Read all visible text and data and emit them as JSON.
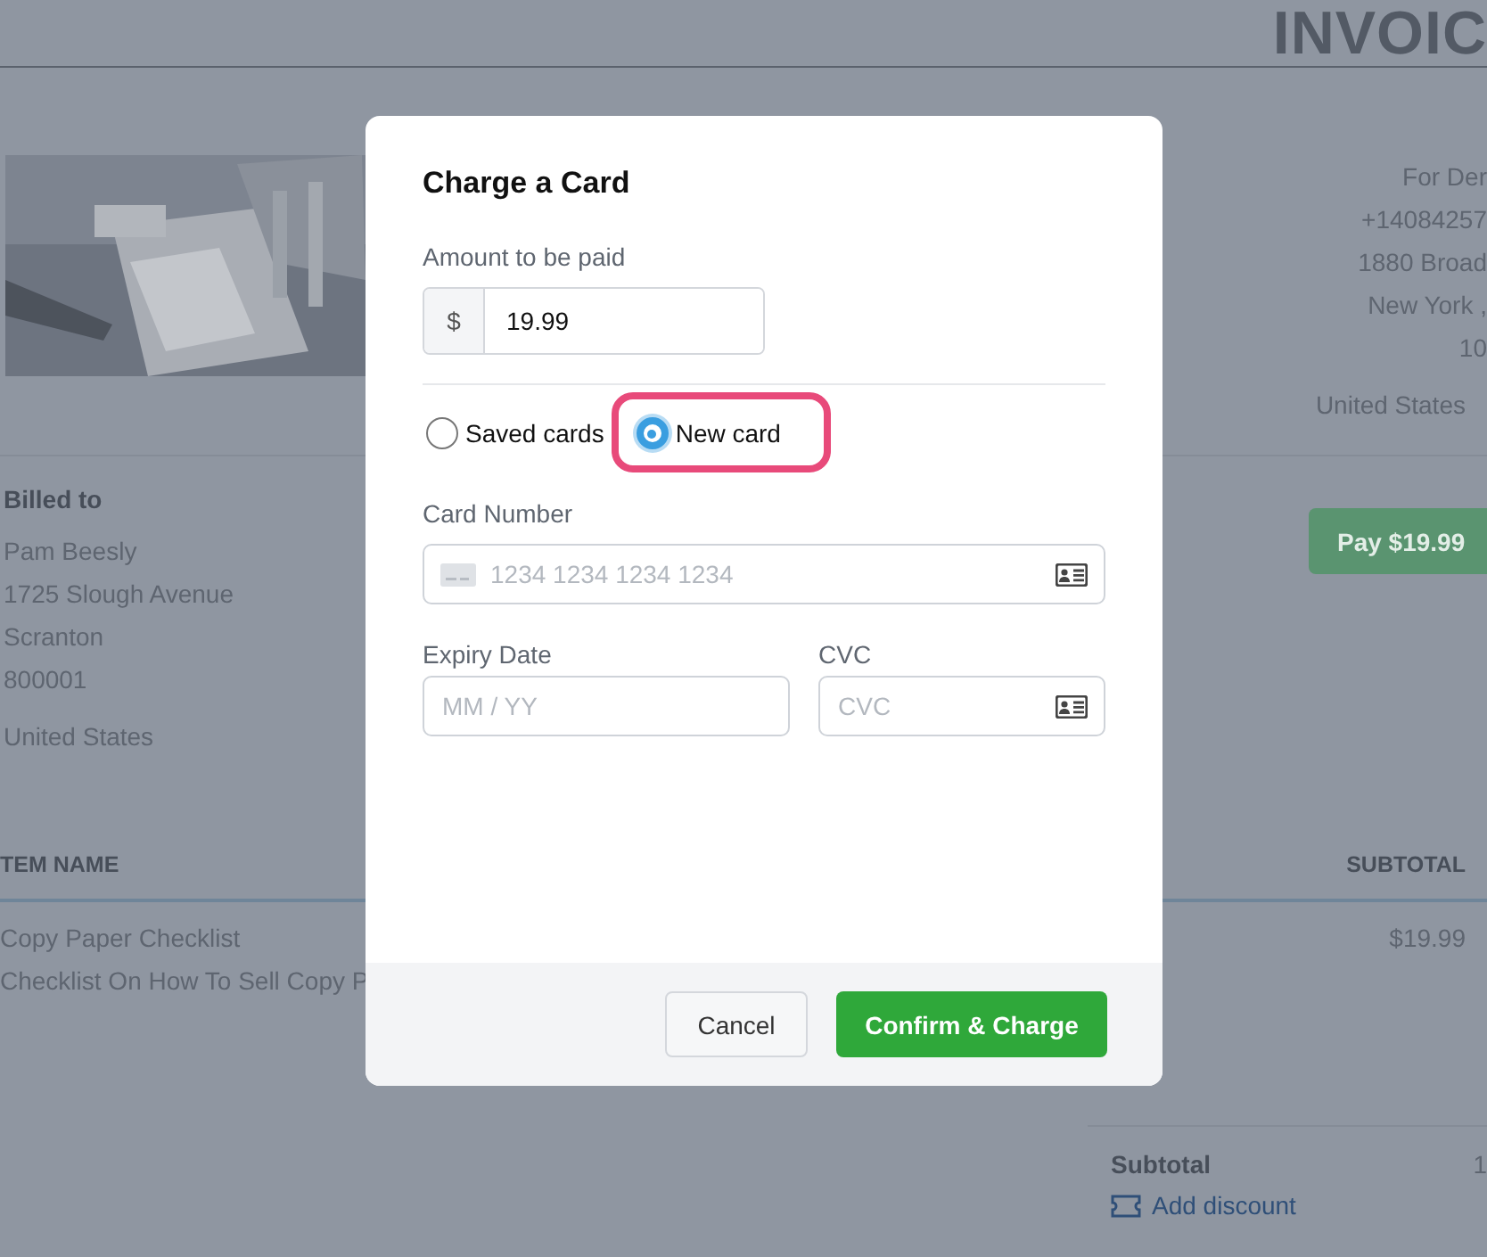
{
  "invoice": {
    "title": "INVOIC",
    "vendor_lines": [
      "For Der",
      "+14084257",
      "1880 Broad",
      "New York ,",
      "10"
    ],
    "vendor_country": "United States",
    "pay_button": "Pay $19.99",
    "billed_to": {
      "heading": "Billed to",
      "lines": [
        "Pam Beesly",
        "1725 Slough Avenue",
        "Scranton",
        "800001"
      ],
      "country": "United States"
    },
    "table": {
      "columns": [
        "TEM NAME",
        "SUBTOTAL"
      ],
      "rows": [
        {
          "name": "Copy Paper Checklist",
          "description": "Checklist On How To Sell Copy P",
          "subtotal": "$19.99"
        }
      ]
    },
    "summary": {
      "subtotal_label": "Subtotal",
      "subtotal_value": "1",
      "add_discount": "Add discount"
    }
  },
  "modal": {
    "title": "Charge a Card",
    "amount": {
      "label": "Amount to be paid",
      "prefix": "$",
      "value": "19.99"
    },
    "card_options": [
      {
        "label": "Saved cards",
        "selected": false,
        "highlighted": false
      },
      {
        "label": "New card",
        "selected": true,
        "highlighted": true
      }
    ],
    "card_number": {
      "label": "Card Number",
      "placeholder": "1234 1234 1234 1234"
    },
    "expiry": {
      "label": "Expiry Date",
      "placeholder": "MM / YY"
    },
    "cvc": {
      "label": "CVC",
      "placeholder": "CVC"
    },
    "buttons": [
      {
        "label": "Cancel",
        "kind": "secondary"
      },
      {
        "label": "Confirm & Charge",
        "kind": "primary"
      }
    ]
  }
}
